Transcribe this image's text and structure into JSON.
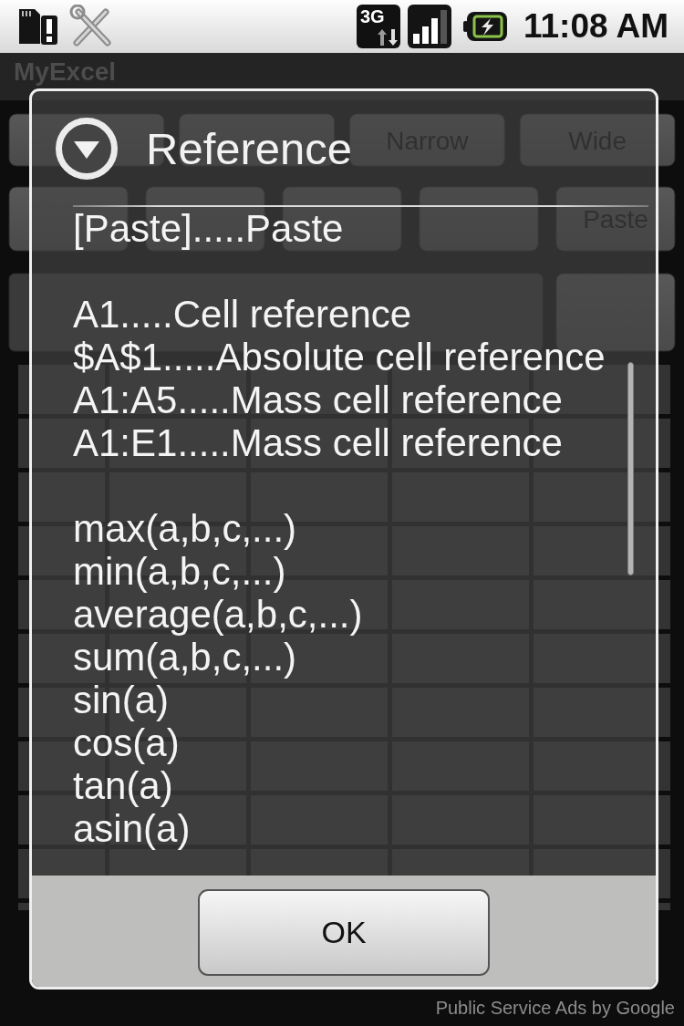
{
  "status_bar": {
    "network": "3G",
    "time": "11:08 AM"
  },
  "app": {
    "title": "MyExcel",
    "toolbar_rows": [
      {
        "buttons": [
          "Narrow",
          "Wide"
        ]
      },
      {
        "buttons": [
          "Paste"
        ]
      }
    ]
  },
  "dialog": {
    "title": "Reference",
    "sections": [
      [
        "[Paste].....Paste"
      ],
      [
        "A1.....Cell reference",
        "$A$1.....Absolute cell reference",
        "A1:A5.....Mass cell reference",
        "A1:E1.....Mass cell reference"
      ],
      [
        "max(a,b,c,...)",
        "min(a,b,c,...)",
        "average(a,b,c,...)",
        "sum(a,b,c,...)",
        "sin(a)",
        "cos(a)",
        "tan(a)",
        "asin(a)"
      ]
    ],
    "ok_button": "OK"
  },
  "footer": {
    "ad_text": "Public Service Ads by Google"
  }
}
